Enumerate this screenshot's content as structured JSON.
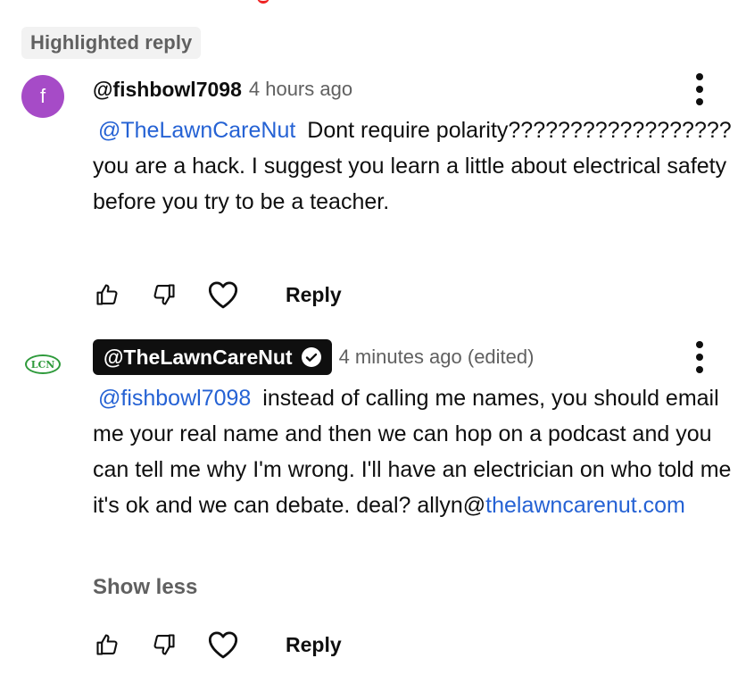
{
  "highlight_badge": "Highlighted reply",
  "comments": [
    {
      "avatar_letter": "f",
      "avatar_color": "#a64bc7",
      "author": "@fishbowl7098",
      "time": "4 hours ago",
      "mention": "@TheLawnCareNut",
      "text": "Dont require polarity?????????????????? you are a hack. I suggest you learn a little about electrical safety before you try to be a teacher.",
      "reply_label": "Reply"
    },
    {
      "avatar_logo_text": "LCN",
      "author": "@TheLawnCareNut",
      "verified": true,
      "time": "4 minutes ago (edited)",
      "mention": "@fishbowl7098",
      "text": "instead of calling me names, you should email me your real name and then we can hop on a podcast and you can tell me why I'm wrong. I'll have an electrician on who told me it's ok and we can debate. deal? allyn@",
      "link": "thelawncarenut.com",
      "show_less": "Show less",
      "reply_label": "Reply"
    }
  ],
  "icons": [
    "like-icon",
    "dislike-icon",
    "heart-icon",
    "more-vert-icon",
    "verified-check-icon"
  ],
  "colors": {
    "link": "#2562d4",
    "secondary_text": "#606060",
    "primary_text": "#0f0f0f"
  }
}
